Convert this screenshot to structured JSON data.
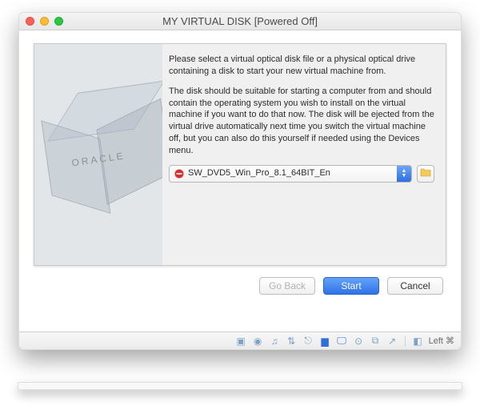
{
  "window": {
    "title": "MY VIRTUAL DISK [Powered Off]"
  },
  "dialog": {
    "oracle_label": "ORACLE",
    "para1": "Please select a virtual optical disk file or a physical optical drive containing a disk to start your new virtual machine from.",
    "para2": "The disk should be suitable for starting a computer from and should contain the operating system you wish to install on the virtual machine if you want to do that now. The disk will be ejected from the virtual drive automatically next time you switch the virtual machine off, but you can also do this yourself if needed using the Devices menu.",
    "selected_disk": "SW_DVD5_Win_Pro_8.1_64BIT_En"
  },
  "buttons": {
    "go_back": "Go Back",
    "start": "Start",
    "cancel": "Cancel"
  },
  "status": {
    "host_key": "Left ⌘"
  }
}
